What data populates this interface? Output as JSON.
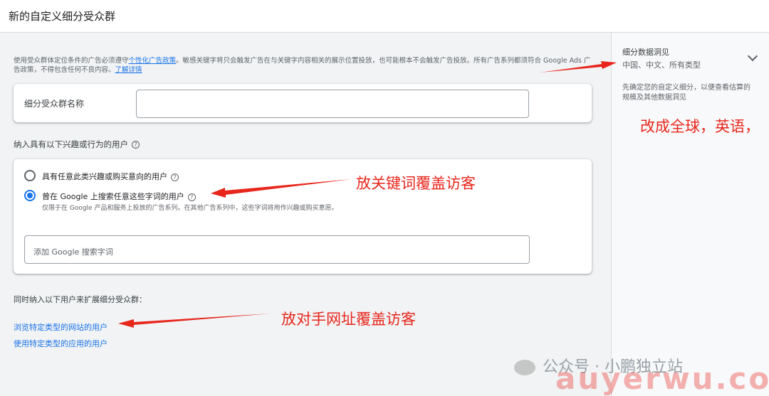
{
  "header": {
    "title": "新的自定义细分受众群"
  },
  "notice": {
    "text_before": "使用受众群体定位条件的广告必须遵守",
    "link1": "个性化广告政策",
    "text_middle": "。敏感关键字将只会触发广告在与关键字内容相关的展示位置投放，也可能根本不会触发广告投放。所有广告系列都须符合 Google Ads 广告政策，不得包含任何不良内容。",
    "link2": "了解详情"
  },
  "segment_name": {
    "label": "细分受众群名称",
    "value": ""
  },
  "include_section": {
    "label": "纳入具有以下兴趣或行为的用户"
  },
  "options": [
    {
      "label": "具有任意此类兴趣或购买意向的用户",
      "selected": false
    },
    {
      "label": "曾在 Google 上搜索任意这些字词的用户",
      "selected": true,
      "sub": "仅限于在 Google 产品和服务上投放的广告系列。在其他广告系列中，这些字词将用作兴趣或购买意愿。"
    }
  ],
  "search_terms_input": {
    "placeholder": "添加 Google 搜索字词"
  },
  "expand_section": {
    "label": "同时纳入以下用户来扩展细分受众群：",
    "links": [
      "浏览特定类型的网站的用户",
      "使用特定类型的应用的用户"
    ]
  },
  "insights": {
    "title": "细分数据洞见",
    "value": "中国、中文、所有类型",
    "desc": "先确定您的自定义细分，以便查看估算的规模及其他数据洞见"
  },
  "annotations": {
    "a1": "改成全球，英语，",
    "a2": "放关键词覆盖访客",
    "a3": "放对手网址覆盖访客"
  },
  "watermark": {
    "text": "公众号 · 小鹏独立站",
    "domain": "auyerwu.com"
  },
  "colors": {
    "link": "#1a73e8",
    "annotation": "#e8261c"
  }
}
